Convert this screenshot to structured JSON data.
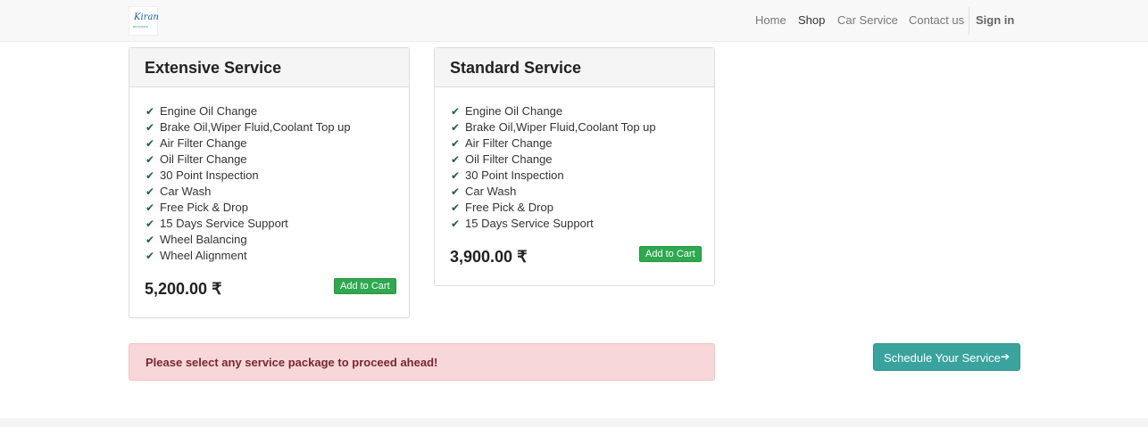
{
  "navbar": {
    "logo_text": "Kiran",
    "logo_sub": "services",
    "links": [
      "Home",
      "Shop",
      "Car Service",
      "Contact us"
    ],
    "active": "Shop",
    "signin": "Sign in"
  },
  "packages": [
    {
      "title": "Extensive Service",
      "features": [
        "Engine Oil Change",
        "Brake Oil,Wiper Fluid,Coolant Top up",
        "Air Filter Change",
        "Oil Filter Change",
        "30 Point Inspection",
        "Car Wash",
        "Free Pick & Drop",
        "15 Days Service Support",
        "Wheel Balancing",
        "Wheel Alignment"
      ],
      "price": "5,200.00 ₹",
      "button": "Add to Cart"
    },
    {
      "title": "Standard Service",
      "features": [
        "Engine Oil Change",
        "Brake Oil,Wiper Fluid,Coolant Top up",
        "Air Filter Change",
        "Oil Filter Change",
        "30 Point Inspection",
        "Car Wash",
        "Free Pick & Drop",
        "15 Days Service Support"
      ],
      "price": "3,900.00 ₹",
      "button": "Add to Cart"
    }
  ],
  "alert": {
    "text": "Please select any service package to proceed ahead!"
  },
  "schedule_button": {
    "label": "Schedule Your Service",
    "icon": "arrow-right-icon"
  },
  "colors": {
    "check": "#1f5c4a",
    "cart_button": "#2fa84f",
    "schedule_button": "#3aa39d",
    "alert_bg": "#f8d7da"
  }
}
